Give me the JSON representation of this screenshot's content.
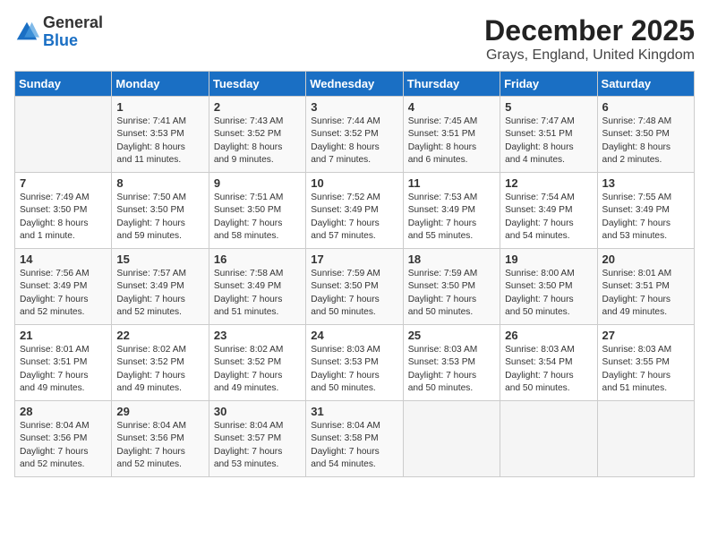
{
  "header": {
    "logo_general": "General",
    "logo_blue": "Blue",
    "month": "December 2025",
    "location": "Grays, England, United Kingdom"
  },
  "weekdays": [
    "Sunday",
    "Monday",
    "Tuesday",
    "Wednesday",
    "Thursday",
    "Friday",
    "Saturday"
  ],
  "weeks": [
    [
      {
        "day": "",
        "info": ""
      },
      {
        "day": "1",
        "info": "Sunrise: 7:41 AM\nSunset: 3:53 PM\nDaylight: 8 hours\nand 11 minutes."
      },
      {
        "day": "2",
        "info": "Sunrise: 7:43 AM\nSunset: 3:52 PM\nDaylight: 8 hours\nand 9 minutes."
      },
      {
        "day": "3",
        "info": "Sunrise: 7:44 AM\nSunset: 3:52 PM\nDaylight: 8 hours\nand 7 minutes."
      },
      {
        "day": "4",
        "info": "Sunrise: 7:45 AM\nSunset: 3:51 PM\nDaylight: 8 hours\nand 6 minutes."
      },
      {
        "day": "5",
        "info": "Sunrise: 7:47 AM\nSunset: 3:51 PM\nDaylight: 8 hours\nand 4 minutes."
      },
      {
        "day": "6",
        "info": "Sunrise: 7:48 AM\nSunset: 3:50 PM\nDaylight: 8 hours\nand 2 minutes."
      }
    ],
    [
      {
        "day": "7",
        "info": "Sunrise: 7:49 AM\nSunset: 3:50 PM\nDaylight: 8 hours\nand 1 minute."
      },
      {
        "day": "8",
        "info": "Sunrise: 7:50 AM\nSunset: 3:50 PM\nDaylight: 7 hours\nand 59 minutes."
      },
      {
        "day": "9",
        "info": "Sunrise: 7:51 AM\nSunset: 3:50 PM\nDaylight: 7 hours\nand 58 minutes."
      },
      {
        "day": "10",
        "info": "Sunrise: 7:52 AM\nSunset: 3:49 PM\nDaylight: 7 hours\nand 57 minutes."
      },
      {
        "day": "11",
        "info": "Sunrise: 7:53 AM\nSunset: 3:49 PM\nDaylight: 7 hours\nand 55 minutes."
      },
      {
        "day": "12",
        "info": "Sunrise: 7:54 AM\nSunset: 3:49 PM\nDaylight: 7 hours\nand 54 minutes."
      },
      {
        "day": "13",
        "info": "Sunrise: 7:55 AM\nSunset: 3:49 PM\nDaylight: 7 hours\nand 53 minutes."
      }
    ],
    [
      {
        "day": "14",
        "info": "Sunrise: 7:56 AM\nSunset: 3:49 PM\nDaylight: 7 hours\nand 52 minutes."
      },
      {
        "day": "15",
        "info": "Sunrise: 7:57 AM\nSunset: 3:49 PM\nDaylight: 7 hours\nand 52 minutes."
      },
      {
        "day": "16",
        "info": "Sunrise: 7:58 AM\nSunset: 3:49 PM\nDaylight: 7 hours\nand 51 minutes."
      },
      {
        "day": "17",
        "info": "Sunrise: 7:59 AM\nSunset: 3:50 PM\nDaylight: 7 hours\nand 50 minutes."
      },
      {
        "day": "18",
        "info": "Sunrise: 7:59 AM\nSunset: 3:50 PM\nDaylight: 7 hours\nand 50 minutes."
      },
      {
        "day": "19",
        "info": "Sunrise: 8:00 AM\nSunset: 3:50 PM\nDaylight: 7 hours\nand 50 minutes."
      },
      {
        "day": "20",
        "info": "Sunrise: 8:01 AM\nSunset: 3:51 PM\nDaylight: 7 hours\nand 49 minutes."
      }
    ],
    [
      {
        "day": "21",
        "info": "Sunrise: 8:01 AM\nSunset: 3:51 PM\nDaylight: 7 hours\nand 49 minutes."
      },
      {
        "day": "22",
        "info": "Sunrise: 8:02 AM\nSunset: 3:52 PM\nDaylight: 7 hours\nand 49 minutes."
      },
      {
        "day": "23",
        "info": "Sunrise: 8:02 AM\nSunset: 3:52 PM\nDaylight: 7 hours\nand 49 minutes."
      },
      {
        "day": "24",
        "info": "Sunrise: 8:03 AM\nSunset: 3:53 PM\nDaylight: 7 hours\nand 50 minutes."
      },
      {
        "day": "25",
        "info": "Sunrise: 8:03 AM\nSunset: 3:53 PM\nDaylight: 7 hours\nand 50 minutes."
      },
      {
        "day": "26",
        "info": "Sunrise: 8:03 AM\nSunset: 3:54 PM\nDaylight: 7 hours\nand 50 minutes."
      },
      {
        "day": "27",
        "info": "Sunrise: 8:03 AM\nSunset: 3:55 PM\nDaylight: 7 hours\nand 51 minutes."
      }
    ],
    [
      {
        "day": "28",
        "info": "Sunrise: 8:04 AM\nSunset: 3:56 PM\nDaylight: 7 hours\nand 52 minutes."
      },
      {
        "day": "29",
        "info": "Sunrise: 8:04 AM\nSunset: 3:56 PM\nDaylight: 7 hours\nand 52 minutes."
      },
      {
        "day": "30",
        "info": "Sunrise: 8:04 AM\nSunset: 3:57 PM\nDaylight: 7 hours\nand 53 minutes."
      },
      {
        "day": "31",
        "info": "Sunrise: 8:04 AM\nSunset: 3:58 PM\nDaylight: 7 hours\nand 54 minutes."
      },
      {
        "day": "",
        "info": ""
      },
      {
        "day": "",
        "info": ""
      },
      {
        "day": "",
        "info": ""
      }
    ]
  ]
}
